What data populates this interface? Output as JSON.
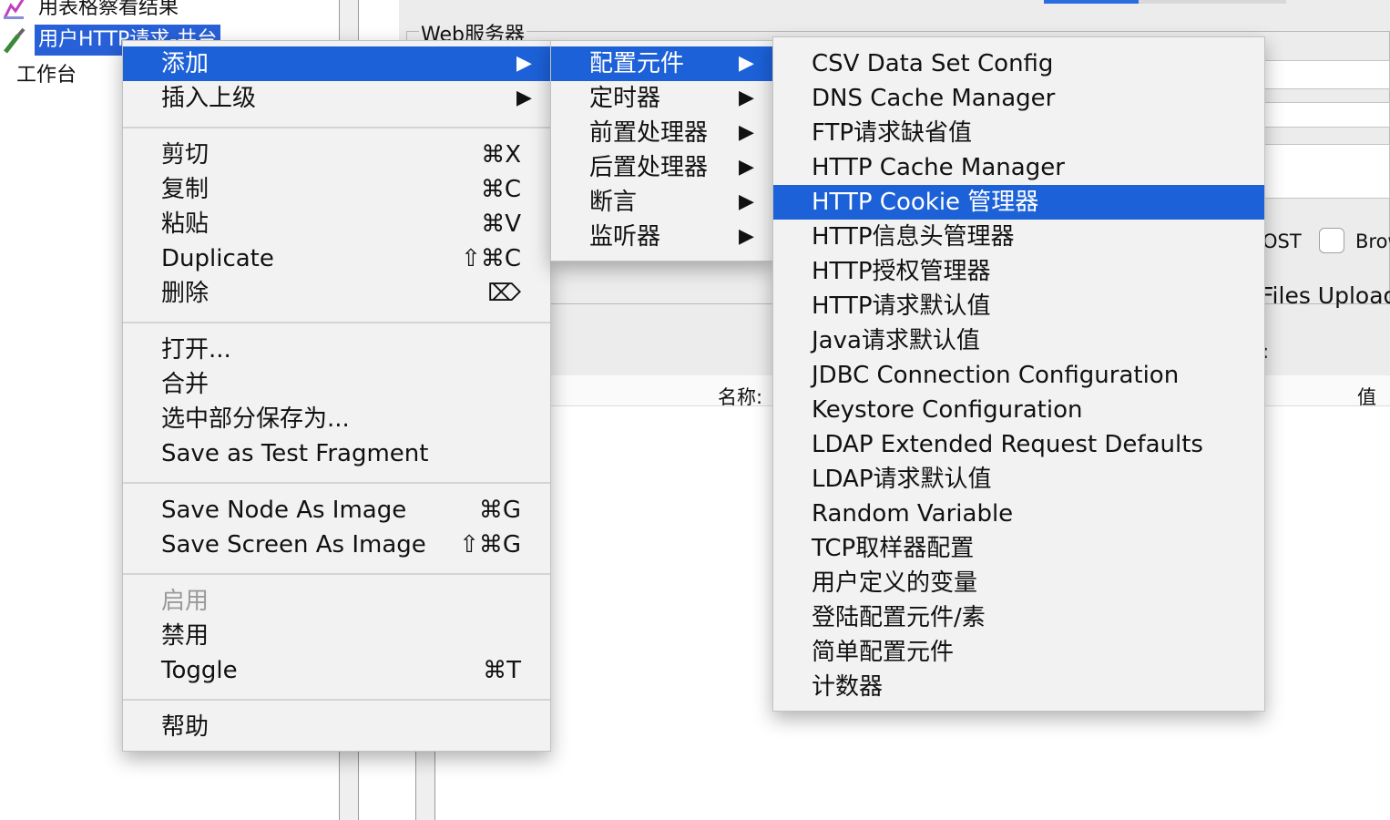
{
  "tree": {
    "items": [
      {
        "label": "用表格察看结果",
        "icon": "chart-icon"
      },
      {
        "label": "用户HTTP请求-井台",
        "icon": "pipette-icon"
      },
      {
        "label": "工作台",
        "icon": ""
      }
    ]
  },
  "panel": {
    "group_title": "Web服务器",
    "name_label": "名称:",
    "value_label": "值",
    "post_label": "OST",
    "browser_label": "Brow",
    "files_label": "Files Upload",
    "colon": ":"
  },
  "context_menu": {
    "items": [
      {
        "label": "添加",
        "submenu": true,
        "highlighted": true
      },
      {
        "label": "插入上级",
        "submenu": true
      },
      {
        "separator": true
      },
      {
        "label": "剪切",
        "shortcut": "⌘X"
      },
      {
        "label": "复制",
        "shortcut": "⌘C"
      },
      {
        "label": "粘贴",
        "shortcut": "⌘V"
      },
      {
        "label": "Duplicate",
        "shortcut": "⇧⌘C"
      },
      {
        "label": "删除",
        "shortcut": "⌦"
      },
      {
        "separator": true
      },
      {
        "label": "打开..."
      },
      {
        "label": "合并"
      },
      {
        "label": "选中部分保存为..."
      },
      {
        "label": "Save as Test Fragment"
      },
      {
        "separator": true
      },
      {
        "label": "Save Node As Image",
        "shortcut": "⌘G"
      },
      {
        "label": "Save Screen As Image",
        "shortcut": "⇧⌘G"
      },
      {
        "separator": true
      },
      {
        "label": "启用",
        "disabled": true
      },
      {
        "label": "禁用"
      },
      {
        "label": "Toggle",
        "shortcut": "⌘T"
      },
      {
        "separator": true
      },
      {
        "label": "帮助"
      }
    ]
  },
  "add_submenu": {
    "items": [
      {
        "label": "配置元件",
        "highlighted": true
      },
      {
        "label": "定时器"
      },
      {
        "label": "前置处理器"
      },
      {
        "label": "后置处理器"
      },
      {
        "label": "断言"
      },
      {
        "label": "监听器"
      }
    ]
  },
  "config_submenu": {
    "items": [
      {
        "label": "CSV Data Set Config"
      },
      {
        "label": "DNS Cache Manager"
      },
      {
        "label": "FTP请求缺省值"
      },
      {
        "label": "HTTP Cache Manager"
      },
      {
        "label": "HTTP Cookie 管理器",
        "highlighted": true
      },
      {
        "label": "HTTP信息头管理器"
      },
      {
        "label": "HTTP授权管理器"
      },
      {
        "label": "HTTP请求默认值"
      },
      {
        "label": "Java请求默认值"
      },
      {
        "label": "JDBC Connection Configuration"
      },
      {
        "label": "Keystore Configuration"
      },
      {
        "label": "LDAP Extended Request Defaults"
      },
      {
        "label": "LDAP请求默认值"
      },
      {
        "label": "Random Variable"
      },
      {
        "label": "TCP取样器配置"
      },
      {
        "label": "用户定义的变量"
      },
      {
        "label": "登陆配置元件/素"
      },
      {
        "label": "简单配置元件"
      },
      {
        "label": "计数器"
      }
    ]
  },
  "colors": {
    "highlight": "#1c61d7",
    "tree_selection": "#2860d8",
    "menu_bg": "#f2f2f2",
    "disabled_text": "#9a9a9a"
  },
  "submenu_arrow": "▶"
}
